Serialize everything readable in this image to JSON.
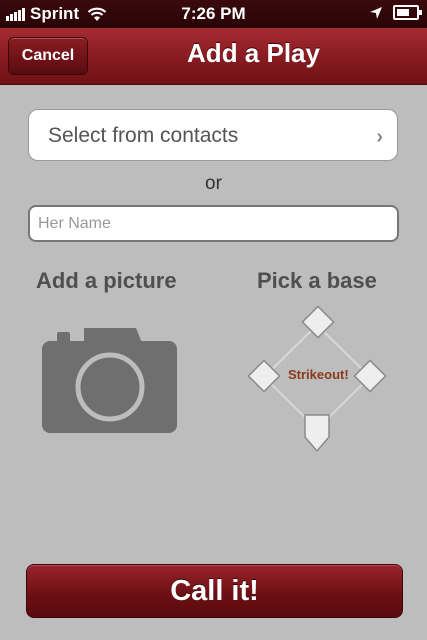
{
  "status_bar": {
    "carrier": "Sprint",
    "time": "7:26 PM",
    "icons": [
      "signal-icon",
      "wifi-icon",
      "location-arrow-icon",
      "battery-charging-icon"
    ]
  },
  "nav": {
    "cancel_label": "Cancel",
    "title": "Add a Play"
  },
  "contacts": {
    "label": "Select from contacts",
    "chevron": "›"
  },
  "or_label": "or",
  "name_field": {
    "placeholder": "Her Name",
    "value": ""
  },
  "picture": {
    "heading": "Add a picture",
    "icon": "camera-icon"
  },
  "base": {
    "heading": "Pick a base",
    "status": "Strikeout!",
    "bases": [
      "second-base",
      "third-base",
      "first-base",
      "home-plate"
    ]
  },
  "call_button": {
    "label": "Call it!"
  },
  "colors": {
    "nav_red": "#8a1c22",
    "background": "#bdbdbd",
    "strikeout_text": "#8a3a1a"
  }
}
